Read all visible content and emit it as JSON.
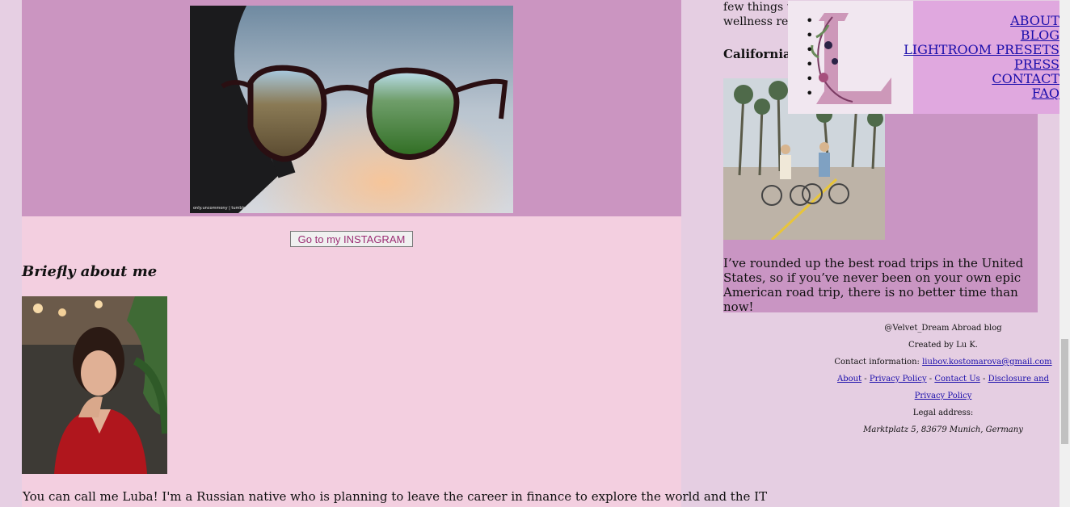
{
  "hero": {
    "credit": "only.uncommony | tumblr"
  },
  "instagram_button": {
    "label": "Go to my INSTAGRAM"
  },
  "about": {
    "heading": "Briefly about me",
    "intro": "You can call me Luba! I'm a Russian native who is planning to leave the career in finance to explore the world and the IT"
  },
  "blog": {
    "partial_line_1": "few things th",
    "partial_line_2": "wellness retr",
    "post_title": "California R",
    "post_text": "I’ve rounded up the best road trips in the United States, so if you’ve never been on your own epic American road trip, there is no better time than now!"
  },
  "nav": {
    "items": [
      "ABOUT",
      "BLOG",
      "LIGHTROOM PRESETS",
      "PRESS",
      "CONTACT",
      "FAQ"
    ]
  },
  "footer": {
    "brand": "@Velvet_Dream Abroad blog",
    "created_by": "Created by Lu K.",
    "contact_label": "Contact information:",
    "contact_email": "liubov.kostomarova@gmail.com",
    "links": [
      "About",
      "Privacy Policy",
      "Contact Us",
      "Disclosure and Privacy Policy"
    ],
    "separator": " - ",
    "legal_label": "Legal address:",
    "legal_address": "Marktplatz 5, 83679 Munich, Germany"
  },
  "colors": {
    "hero_band": "#cb95c1",
    "left_column": "#f3cfe0",
    "page_bg": "#e5cee2",
    "nav_bg": "#e0a8df",
    "button_text": "#9b2c73",
    "link": "#1a0dab"
  }
}
